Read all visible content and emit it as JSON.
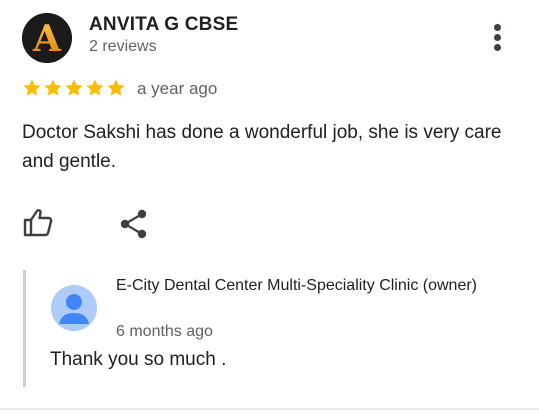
{
  "review": {
    "reviewer_name": "ANVITA G CBSE",
    "reviewer_initial": "A",
    "review_count": "2 reviews",
    "rating": 5,
    "rating_max": 5,
    "time_ago": "a year ago",
    "text": "Doctor Sakshi has done a wonderful job, she is very care and gentle."
  },
  "reply": {
    "owner_name": "E-City Dental Center Multi-Speciality Clinic (owner)",
    "time_ago": "6 months ago",
    "text": "Thank you so much ."
  },
  "icons": {
    "more": "more-vert-icon",
    "like": "thumb-up-icon",
    "share": "share-icon",
    "star": "star-icon",
    "owner_avatar": "person-icon"
  },
  "colors": {
    "star": "#fbbc04",
    "avatar_bg": "#1a1a1a",
    "avatar_letter": "#f5a623",
    "owner_avatar_bg": "#aecbfa",
    "owner_avatar_fg": "#4285f4",
    "secondary_text": "#5f6368"
  }
}
